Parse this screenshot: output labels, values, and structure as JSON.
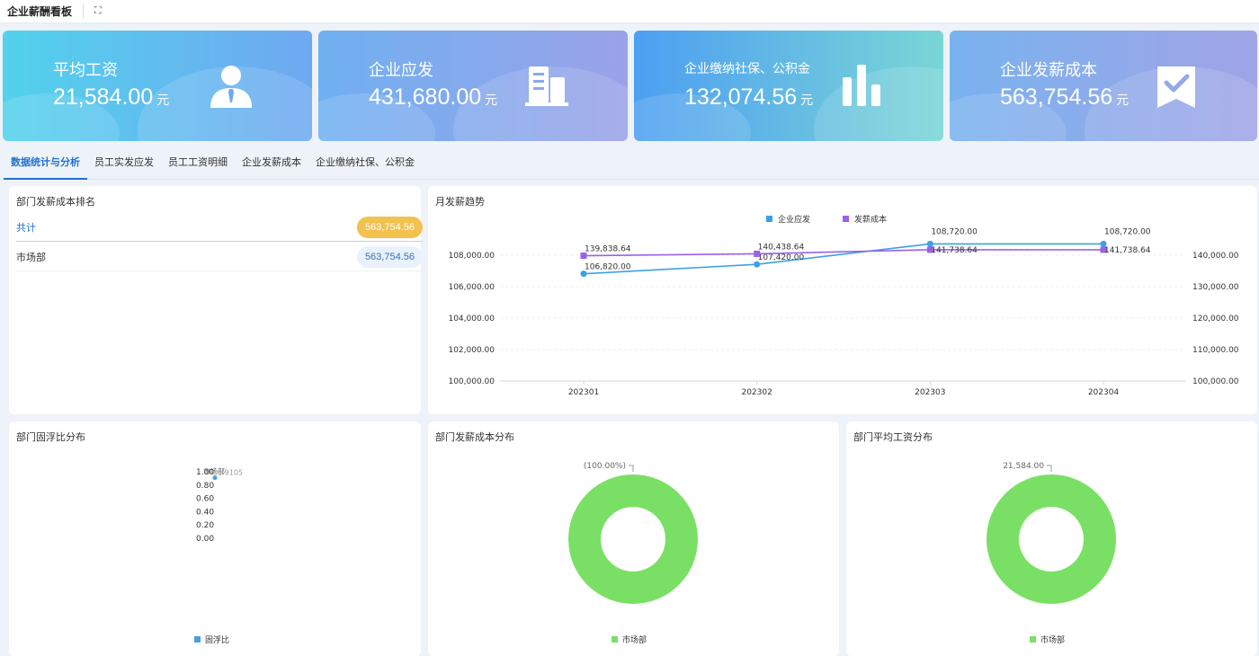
{
  "header": {
    "title": "企业薪酬看板"
  },
  "cards": [
    {
      "label": "平均工资",
      "value": "21,584.00",
      "unit": "元",
      "icon": "person-icon"
    },
    {
      "label": "企业应发",
      "value": "431,680.00",
      "unit": "元",
      "icon": "building-icon"
    },
    {
      "label": "企业缴纳社保、公积金",
      "value": "132,074.56",
      "unit": "元",
      "icon": "bar-chart-icon"
    },
    {
      "label": "企业发薪成本",
      "value": "563,754.56",
      "unit": "元",
      "icon": "bookmark-check-icon"
    }
  ],
  "tabs": [
    {
      "label": "数据统计与分析",
      "active": true
    },
    {
      "label": "员工实发应发"
    },
    {
      "label": "员工工资明细"
    },
    {
      "label": "企业发薪成本"
    },
    {
      "label": "企业缴纳社保、公积金"
    }
  ],
  "ranking": {
    "title": "部门发薪成本排名",
    "total_label": "共计",
    "total_value": "563,754.56",
    "items": [
      {
        "name": "市场部",
        "value": "563,754.56"
      }
    ]
  },
  "colors": {
    "blue": "#3ba1e6",
    "purple": "#9a62e9",
    "green": "#7ae065",
    "gold": "#f2c14e",
    "accent": "#1f6fd6"
  },
  "chart_data": [
    {
      "type": "line",
      "title": "月发薪趋势",
      "x": [
        "202301",
        "202302",
        "202303",
        "202304"
      ],
      "series": [
        {
          "name": "企业应发",
          "axis": "left",
          "color": "#3ba1e6",
          "values": [
            106820.0,
            107420.0,
            108720.0,
            108720.0
          ],
          "labels": [
            "106,820.00",
            "107,420.00",
            "108,720.00",
            "108,720.00"
          ]
        },
        {
          "name": "发薪成本",
          "axis": "right",
          "color": "#9a62e9",
          "values": [
            139838.64,
            140438.64,
            141738.64,
            141738.64
          ],
          "labels": [
            "139,838.64",
            "140,438.64",
            "141,738.64",
            "141,738.64"
          ]
        }
      ],
      "yleft": {
        "min": 100000,
        "max": 108000,
        "ticks": [
          "100,000.00",
          "102,000.00",
          "104,000.00",
          "106,000.00",
          "108,000.00"
        ]
      },
      "yright": {
        "min": 100000,
        "max": 140000,
        "ticks": [
          "100,000.00",
          "110,000.00",
          "120,000.00",
          "130,000.00",
          "140,000.00"
        ]
      },
      "legend": "top-center"
    },
    {
      "type": "scatter",
      "title": "部门固浮比分布",
      "series": [
        {
          "name": "固浮比",
          "color": "#4a9fdc",
          "points": [
            {
              "label": "市场部",
              "value": 0.91,
              "text": "0.9105"
            }
          ]
        }
      ],
      "y_ticks": [
        "1.00",
        "0.80",
        "0.60",
        "0.40",
        "0.20",
        "0.00"
      ],
      "legend": "bottom-center"
    },
    {
      "type": "pie",
      "title": "部门发薪成本分布",
      "slices": [
        {
          "name": "市场部",
          "value": 563754.56,
          "label": "(100.00%)",
          "color": "#7ae065"
        }
      ],
      "legend": "bottom-center"
    },
    {
      "type": "pie",
      "title": "部门平均工资分布",
      "slices": [
        {
          "name": "市场部",
          "value": 21584.0,
          "label": "21,584.00",
          "color": "#7ae065"
        }
      ],
      "legend": "bottom-center"
    }
  ]
}
